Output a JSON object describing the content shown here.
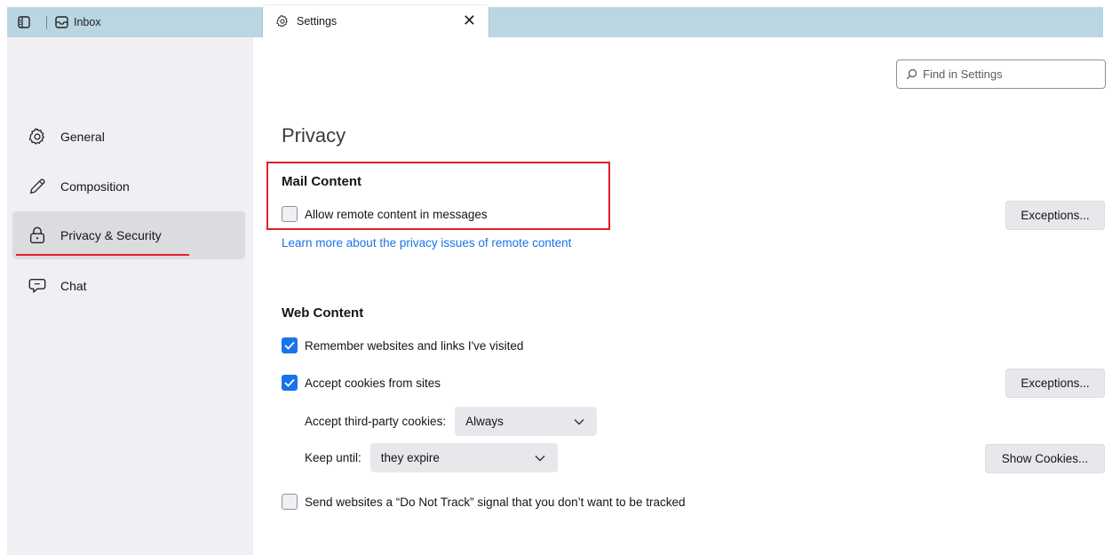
{
  "tabs": {
    "inbox_label": "Inbox",
    "settings_label": "Settings",
    "close_glyph": "✕"
  },
  "sidebar": {
    "items": [
      {
        "label": "General",
        "icon": "gear-icon"
      },
      {
        "label": "Composition",
        "icon": "pencil-icon"
      },
      {
        "label": "Privacy & Security",
        "icon": "lock-icon",
        "selected": true
      },
      {
        "label": "Chat",
        "icon": "chat-icon"
      }
    ]
  },
  "search": {
    "placeholder": "Find in Settings"
  },
  "privacy": {
    "title": "Privacy",
    "mail_content": {
      "heading": "Mail Content",
      "allow_remote": {
        "label": "Allow remote content in messages",
        "checked": false
      },
      "exceptions_label": "Exceptions...",
      "learn_more": "Learn more about the privacy issues of remote content"
    },
    "web_content": {
      "heading": "Web Content",
      "remember": {
        "label": "Remember websites and links I've visited",
        "checked": true
      },
      "accept_cookies": {
        "label": "Accept cookies from sites",
        "checked": true
      },
      "exceptions_label": "Exceptions...",
      "third_party_label": "Accept third-party cookies:",
      "third_party_value": "Always",
      "keep_until_label": "Keep until:",
      "keep_until_value": "they expire",
      "show_cookies_label": "Show Cookies...",
      "dnt": {
        "label": "Send websites a “Do Not Track” signal that you don’t want to be tracked",
        "checked": false
      }
    }
  },
  "colors": {
    "accent": "#1a73e8",
    "highlight": "#e2202c",
    "tabstrip": "#b9d6e2"
  }
}
